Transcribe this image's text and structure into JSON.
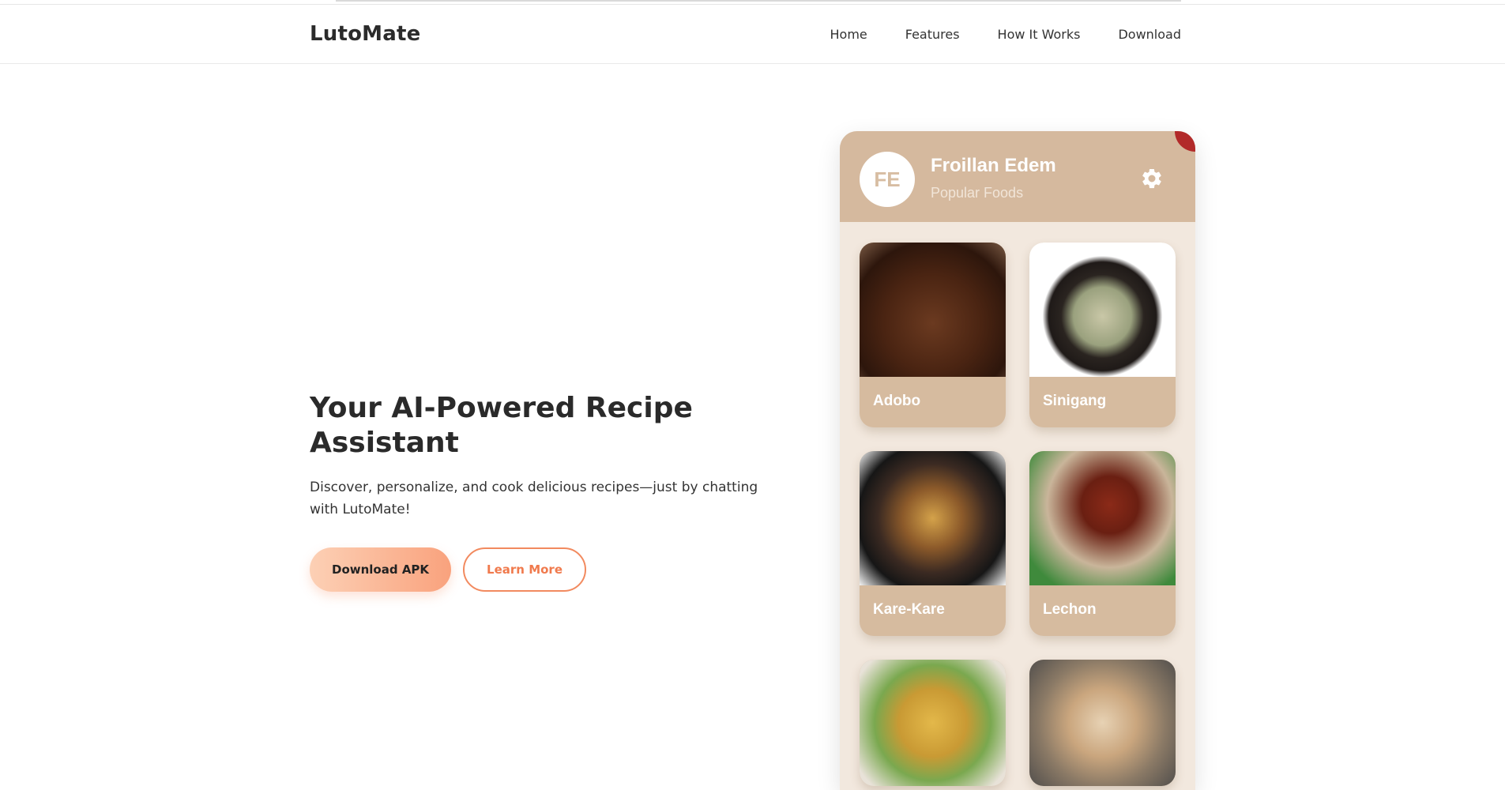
{
  "brand": "LutoMate",
  "nav": {
    "items": [
      "Home",
      "Features",
      "How It Works",
      "Download"
    ]
  },
  "hero": {
    "title": "Your AI-Powered Recipe Assistant",
    "description": "Discover, personalize, and cook delicious recipes—just by chatting with LutoMate!",
    "primary_button": "Download APK",
    "secondary_button": "Learn More"
  },
  "app_preview": {
    "avatar_initials": "FE",
    "user_name": "Froillan Edem",
    "subtitle": "Popular Foods",
    "settings_icon": "gear-icon",
    "foods": [
      {
        "label": "Adobo"
      },
      {
        "label": "Sinigang"
      },
      {
        "label": "Kare-Kare"
      },
      {
        "label": "Lechon"
      }
    ]
  },
  "colors": {
    "accent": "#F9A27D",
    "accent_outline": "#F28A5F",
    "app_header": "#D5B99E",
    "card": "#D6BB9F",
    "app_background": "#F2E8DE"
  }
}
